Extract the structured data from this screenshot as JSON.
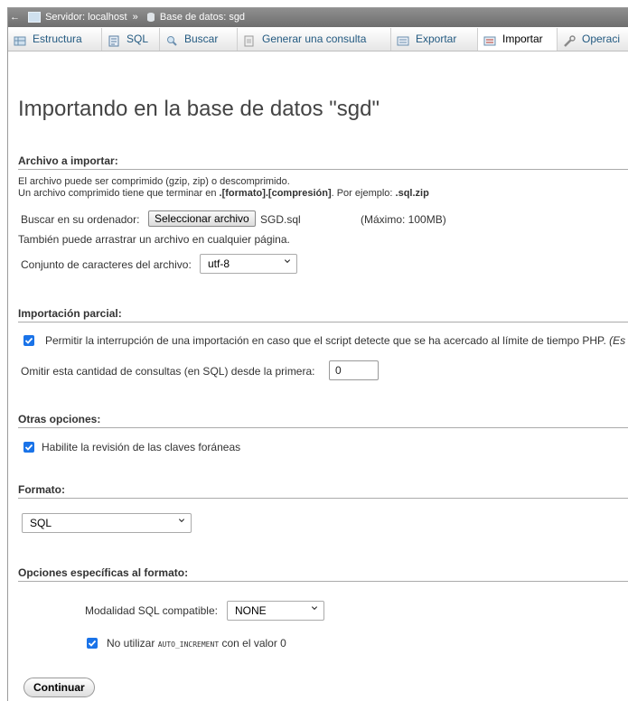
{
  "breadcrumb": {
    "server": "Servidor: localhost",
    "separator": "»",
    "database": "Base de datos: sgd"
  },
  "tabs": [
    {
      "label": "Estructura",
      "icon": "structure-icon"
    },
    {
      "label": "SQL",
      "icon": "sql-icon"
    },
    {
      "label": "Buscar",
      "icon": "search-icon"
    },
    {
      "label": "Generar una consulta",
      "icon": "query-icon"
    },
    {
      "label": "Exportar",
      "icon": "export-icon"
    },
    {
      "label": "Importar",
      "icon": "import-icon",
      "active": true
    },
    {
      "label": "Operaci",
      "icon": "wrench-icon"
    }
  ],
  "page_title": "Importando en la base de datos \"sgd\"",
  "file_section": {
    "title": "Archivo a importar:",
    "line1": "El archivo puede ser comprimido (gzip, zip) o descomprimido.",
    "line2_prefix": "Un archivo comprimido tiene que terminar en ",
    "line2_format": ".[formato].[compresión]",
    "line2_mid": ". Por ejemplo: ",
    "line2_example": ".sql.zip",
    "browse_label": "Buscar en su ordenador:",
    "browse_button": "Seleccionar archivo",
    "file_name": "SGD.sql",
    "max_size": "(Máximo: 100MB)",
    "drag_hint": "También puede arrastrar un archivo en cualquier página.",
    "charset_label": "Conjunto de caracteres del archivo:",
    "charset_value": "utf-8"
  },
  "partial_section": {
    "title": "Importación parcial:",
    "allow_interrupt": "Permitir la interrupción de una importación en caso que el script detecte que se ha acercado al límite de tiempo PHP.",
    "allow_interrupt_tail": "(Es",
    "allow_interrupt_checked": true,
    "skip_label": "Omitir esta cantidad de consultas (en SQL) desde la primera:",
    "skip_value": "0"
  },
  "other_section": {
    "title": "Otras opciones:",
    "fk_label": "Habilite la revisión de las claves foráneas",
    "fk_checked": true
  },
  "format_section": {
    "title": "Formato:",
    "format_value": "SQL"
  },
  "format_specific_section": {
    "title": "Opciones específicas al formato:",
    "compat_label": "Modalidad SQL compatible:",
    "compat_value": "NONE",
    "no_auto_prefix": "No utilizar",
    "no_auto_code": "AUTO_INCREMENT",
    "no_auto_suffix": "con el valor 0",
    "no_auto_checked": true
  },
  "submit_label": "Continuar",
  "colors": {
    "link": "#235a81",
    "checkbox": "#1a73e8",
    "topbar": "#7a7a7a"
  }
}
